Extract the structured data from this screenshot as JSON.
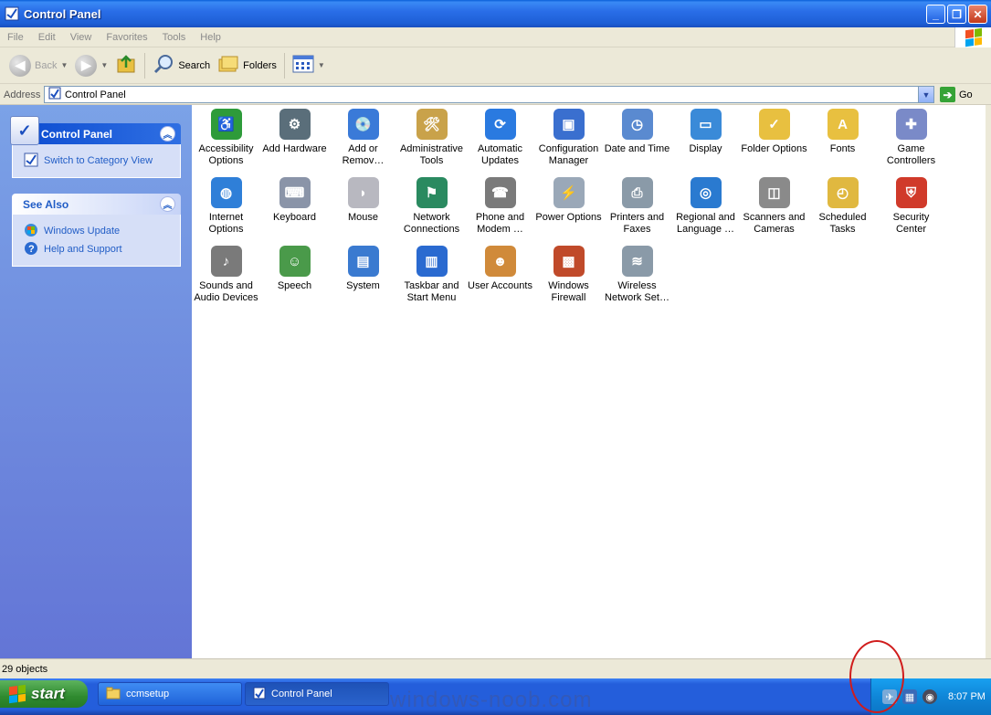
{
  "window": {
    "title": "Control Panel",
    "buttons": [
      "minimize",
      "maximize",
      "close"
    ]
  },
  "menubar": {
    "items": [
      "File",
      "Edit",
      "View",
      "Favorites",
      "Tools",
      "Help"
    ]
  },
  "toolbar": {
    "back_label": "Back",
    "search_label": "Search",
    "folders_label": "Folders"
  },
  "address": {
    "label": "Address",
    "value": "Control Panel",
    "go_label": "Go"
  },
  "sidebar": {
    "control_panel": {
      "title": "Control Panel",
      "link": "Switch to Category View"
    },
    "see_also": {
      "title": "See Also",
      "links": [
        "Windows Update",
        "Help and Support"
      ]
    }
  },
  "items": [
    {
      "label": "Accessibility Options",
      "icon": "accessibility-icon",
      "color": "#2e9b3a"
    },
    {
      "label": "Add Hardware",
      "icon": "add-hardware-icon",
      "color": "#5a6e7a"
    },
    {
      "label": "Add or Remov…",
      "icon": "add-remove-programs-icon",
      "color": "#3a7ad8"
    },
    {
      "label": "Administrative Tools",
      "icon": "administrative-tools-icon",
      "color": "#c9a24a"
    },
    {
      "label": "Automatic Updates",
      "icon": "automatic-updates-icon",
      "color": "#2a7ae0"
    },
    {
      "label": "Configuration Manager",
      "icon": "configuration-manager-icon",
      "color": "#3a6fcf"
    },
    {
      "label": "Date and Time",
      "icon": "date-time-icon",
      "color": "#5a8ad0"
    },
    {
      "label": "Display",
      "icon": "display-icon",
      "color": "#3a8ad8"
    },
    {
      "label": "Folder Options",
      "icon": "folder-options-icon",
      "color": "#e8c040"
    },
    {
      "label": "Fonts",
      "icon": "fonts-icon",
      "color": "#e8c040"
    },
    {
      "label": "Game Controllers",
      "icon": "game-controller-icon",
      "color": "#7a8ac8"
    },
    {
      "label": "Internet Options",
      "icon": "internet-options-icon",
      "color": "#2f7fd8"
    },
    {
      "label": "Keyboard",
      "icon": "keyboard-icon",
      "color": "#8a94a8"
    },
    {
      "label": "Mouse",
      "icon": "mouse-icon",
      "color": "#b8b8c0"
    },
    {
      "label": "Network Connections",
      "icon": "network-connections-icon",
      "color": "#2a8a60"
    },
    {
      "label": "Phone and Modem …",
      "icon": "phone-modem-icon",
      "color": "#7a7a7a"
    },
    {
      "label": "Power Options",
      "icon": "power-options-icon",
      "color": "#9aa8b8"
    },
    {
      "label": "Printers and Faxes",
      "icon": "printers-faxes-icon",
      "color": "#8a9aa8"
    },
    {
      "label": "Regional and Language …",
      "icon": "regional-language-icon",
      "color": "#2a7ad0"
    },
    {
      "label": "Scanners and Cameras",
      "icon": "scanners-cameras-icon",
      "color": "#8a8a8a"
    },
    {
      "label": "Scheduled Tasks",
      "icon": "scheduled-tasks-icon",
      "color": "#e0b840"
    },
    {
      "label": "Security Center",
      "icon": "security-center-icon",
      "color": "#d03a2a"
    },
    {
      "label": "Sounds and Audio Devices",
      "icon": "sounds-icon",
      "color": "#7a7a7a"
    },
    {
      "label": "Speech",
      "icon": "speech-icon",
      "color": "#4a9a4a"
    },
    {
      "label": "System",
      "icon": "system-icon",
      "color": "#3a7ad0"
    },
    {
      "label": "Taskbar and Start Menu",
      "icon": "taskbar-start-menu-icon",
      "color": "#2a6ad0"
    },
    {
      "label": "User Accounts",
      "icon": "user-accounts-icon",
      "color": "#d08a3a"
    },
    {
      "label": "Windows Firewall",
      "icon": "windows-firewall-icon",
      "color": "#c04a2a"
    },
    {
      "label": "Wireless Network Set…",
      "icon": "wireless-network-icon",
      "color": "#8a9aa8"
    }
  ],
  "status": {
    "text": "29 objects"
  },
  "taskbar": {
    "start_label": "start",
    "tasks": [
      "ccmsetup",
      "Control Panel"
    ],
    "clock": "8:07 PM"
  },
  "watermark": "windows-noob.com"
}
